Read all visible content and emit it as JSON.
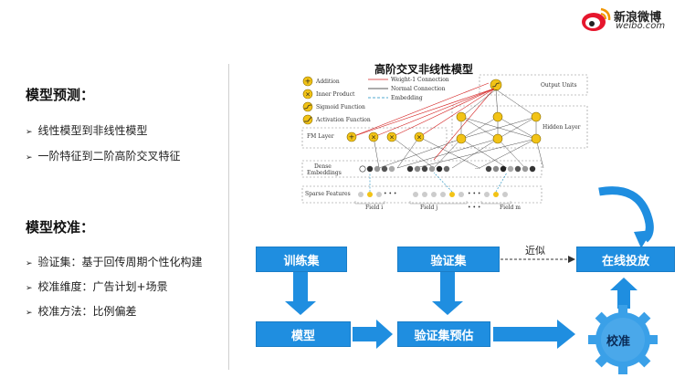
{
  "logo": {
    "brand": "新浪微博",
    "domain": "weibo.com"
  },
  "left": {
    "section1_title": "模型预测：",
    "section1_items": [
      "线性模型到非线性模型",
      "一阶特征到二阶高阶交叉特征"
    ],
    "section2_title": "模型校准：",
    "section2_items": [
      "验证集：基于回传周期个性化构建",
      "校准维度：广告计划+场景",
      "校准方法：比例偏差"
    ]
  },
  "network": {
    "title": "高阶交叉非线性模型",
    "legend_left": [
      "Addition",
      "Inner Product",
      "Sigmoid Function",
      "Activation Function"
    ],
    "legend_right": [
      "Weight-1 Connection",
      "Normal Connection",
      "Embedding"
    ],
    "output_units": "Output Units",
    "fm_layer": "FM Layer",
    "hidden_layer": "Hidden Layer",
    "dense_embeddings_1": "Dense",
    "dense_embeddings_2": "Embeddings",
    "sparse_features": "Sparse Features",
    "fields": [
      "Field i",
      "Field j",
      "Field m"
    ],
    "ellipsis": "• • •",
    "dots": "..."
  },
  "flow": {
    "train": "训练集",
    "validate": "验证集",
    "online": "在线投放",
    "model": "模型",
    "predict": "验证集预估",
    "calibrate": "校准",
    "approx": "近似"
  },
  "colors": {
    "box": "#1f8ee0",
    "gear": "#3aa0e8",
    "node_yellow": "#f2c316",
    "red_line": "#d42020"
  }
}
